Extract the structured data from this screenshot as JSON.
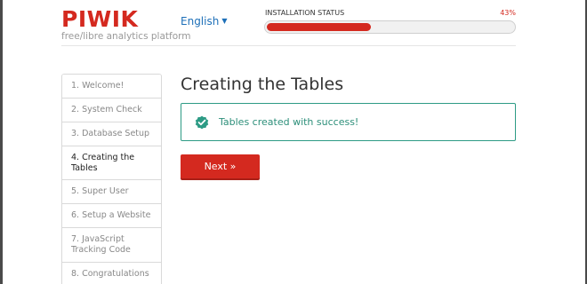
{
  "header": {
    "logo": "PIWIK",
    "tagline": "free/libre analytics platform",
    "language": "English",
    "language_caret": "▼"
  },
  "install_status": {
    "label": "INSTALLATION STATUS",
    "percent_label": "43%",
    "progress_fraction": 0.43
  },
  "sidebar": {
    "steps": [
      {
        "label": "1. Welcome!",
        "active": false
      },
      {
        "label": "2. System Check",
        "active": false
      },
      {
        "label": "3. Database Setup",
        "active": false
      },
      {
        "label": "4. Creating the Tables",
        "active": true
      },
      {
        "label": "5. Super User",
        "active": false
      },
      {
        "label": "6. Setup a Website",
        "active": false
      },
      {
        "label": "7. JavaScript Tracking Code",
        "active": false
      },
      {
        "label": "8. Congratulations",
        "active": false
      }
    ]
  },
  "main": {
    "title": "Creating the Tables",
    "success_message": "Tables created with success!",
    "next_button": "Next »"
  },
  "colors": {
    "brand_red": "#d4291f",
    "success_teal": "#2d9b85",
    "link_blue": "#1d6fb8"
  },
  "icons": {
    "alert": "check-badge-icon",
    "language": "caret-down-icon"
  }
}
